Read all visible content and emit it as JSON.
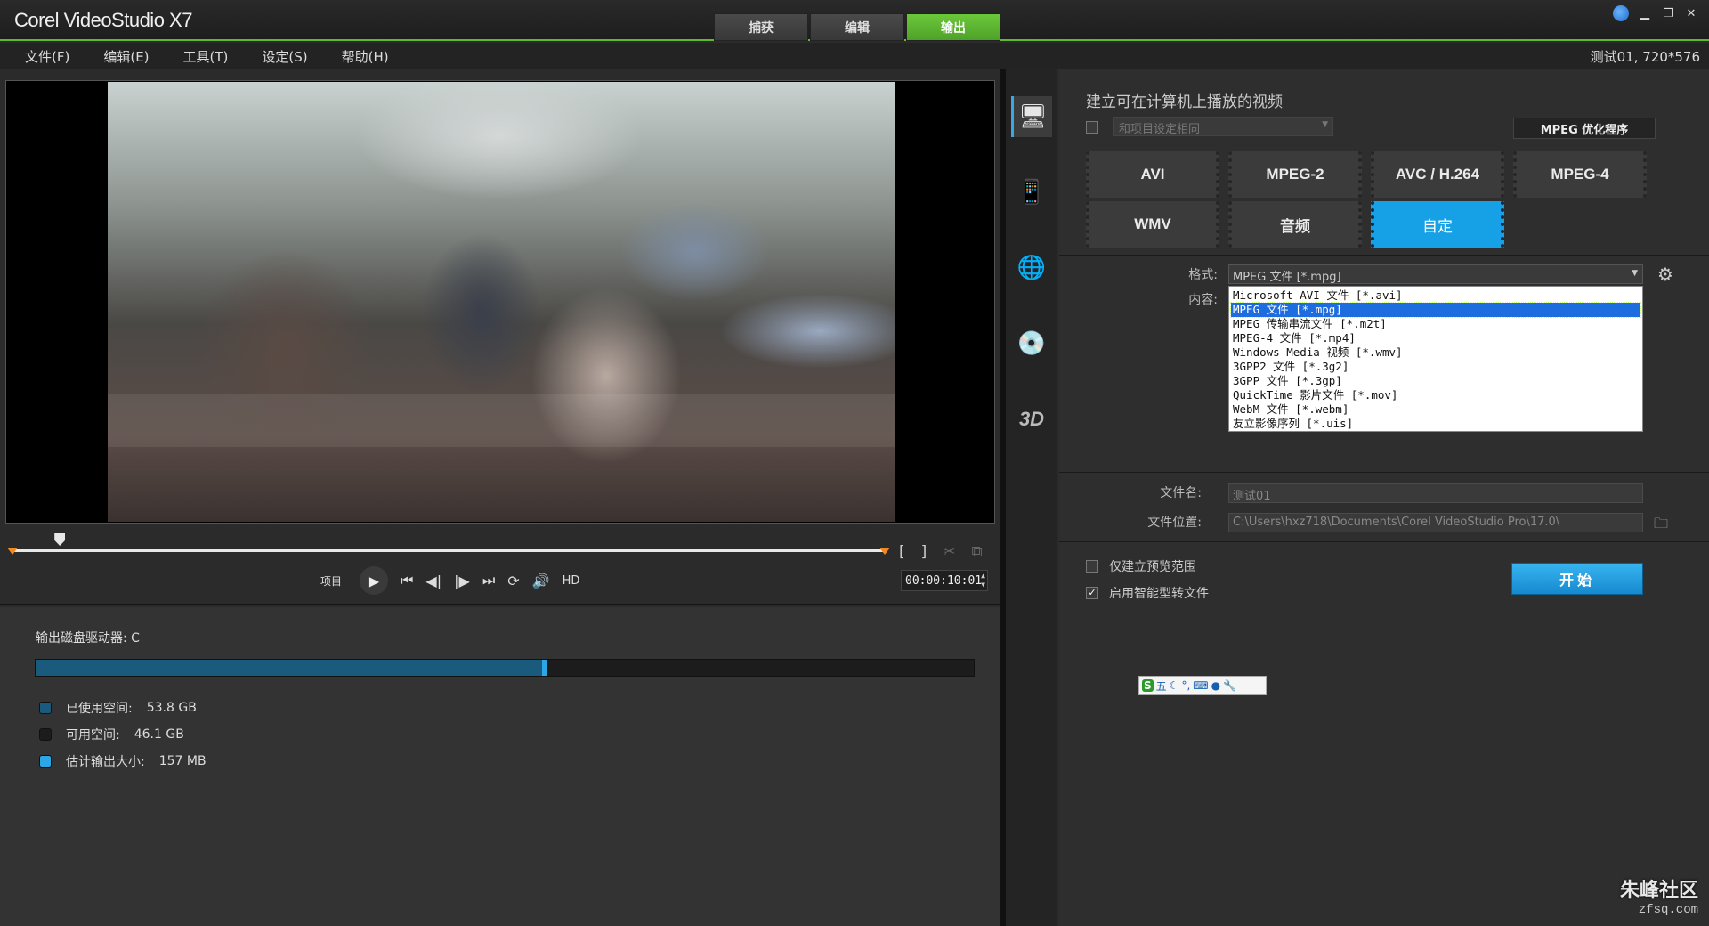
{
  "app": {
    "title": "Corel VideoStudio X7",
    "tabs": [
      "捕获",
      "编辑",
      "输出"
    ],
    "active_tab": "输出"
  },
  "menu": {
    "items": [
      "文件(F)",
      "编辑(E)",
      "工具(T)",
      "设定(S)",
      "帮助(H)"
    ],
    "project_info": "测试01, 720*576"
  },
  "playback": {
    "mode_label": "项目",
    "hd_label": "HD",
    "timecode": "00:00:10:01",
    "trim": {
      "mark_in": "[",
      "mark_out": "]"
    },
    "scrub_position_pct": 5
  },
  "disk": {
    "label": "输出磁盘驱动器: C",
    "used_label": "已使用空间:",
    "used_value": "53.8 GB",
    "free_label": "可用空间:",
    "free_value": "46.1 GB",
    "est_label": "估计输出大小:",
    "est_value": "157 MB",
    "used_fraction": 0.54,
    "colors": {
      "used": "#1a5a7c",
      "free": "#1c1c1c",
      "estimate": "#2ba6e6"
    }
  },
  "side_icons": [
    "computer-icon",
    "device-icon",
    "web-icon",
    "disc-icon",
    "3d-icon"
  ],
  "output": {
    "title": "建立可在计算机上播放的视频",
    "same_as_project": "和项目设定相同",
    "optimizer_button": "MPEG 优化程序",
    "format_buttons": [
      "AVI",
      "MPEG-2",
      "AVC / H.264",
      "MPEG-4",
      "WMV",
      "音频",
      "自定"
    ],
    "active_format": "自定",
    "format_label": "格式:",
    "format_value": "MPEG 文件 [*.mpg]",
    "content_label": "内容:",
    "format_options": [
      "Microsoft AVI 文件 [*.avi]",
      "MPEG 文件 [*.mpg]",
      "MPEG 传输串流文件 [*.m2t]",
      "MPEG-4 文件 [*.mp4]",
      "Windows Media 视频 [*.wmv]",
      "3GPP2 文件 [*.3g2]",
      "3GPP 文件 [*.3gp]",
      "QuickTime 影片文件 [*.mov]",
      "WebM 文件 [*.webm]",
      "友立影像序列 [*.uis]"
    ],
    "selected_option_index": 1,
    "filename_label": "文件名:",
    "filename_value": "测试01",
    "location_label": "文件位置:",
    "location_value": "C:\\Users\\hxz718\\Documents\\Corel VideoStudio Pro\\17.0\\",
    "preview_range_label": "仅建立预览范围",
    "smart_render_label": "启用智能型转文件",
    "smart_render_checked": true,
    "start_button": "开始",
    "accent_color": "#16a0e6"
  },
  "ime": {
    "label": "五"
  },
  "watermark": {
    "title": "朱峰社区",
    "sub": "zfsq.com"
  }
}
